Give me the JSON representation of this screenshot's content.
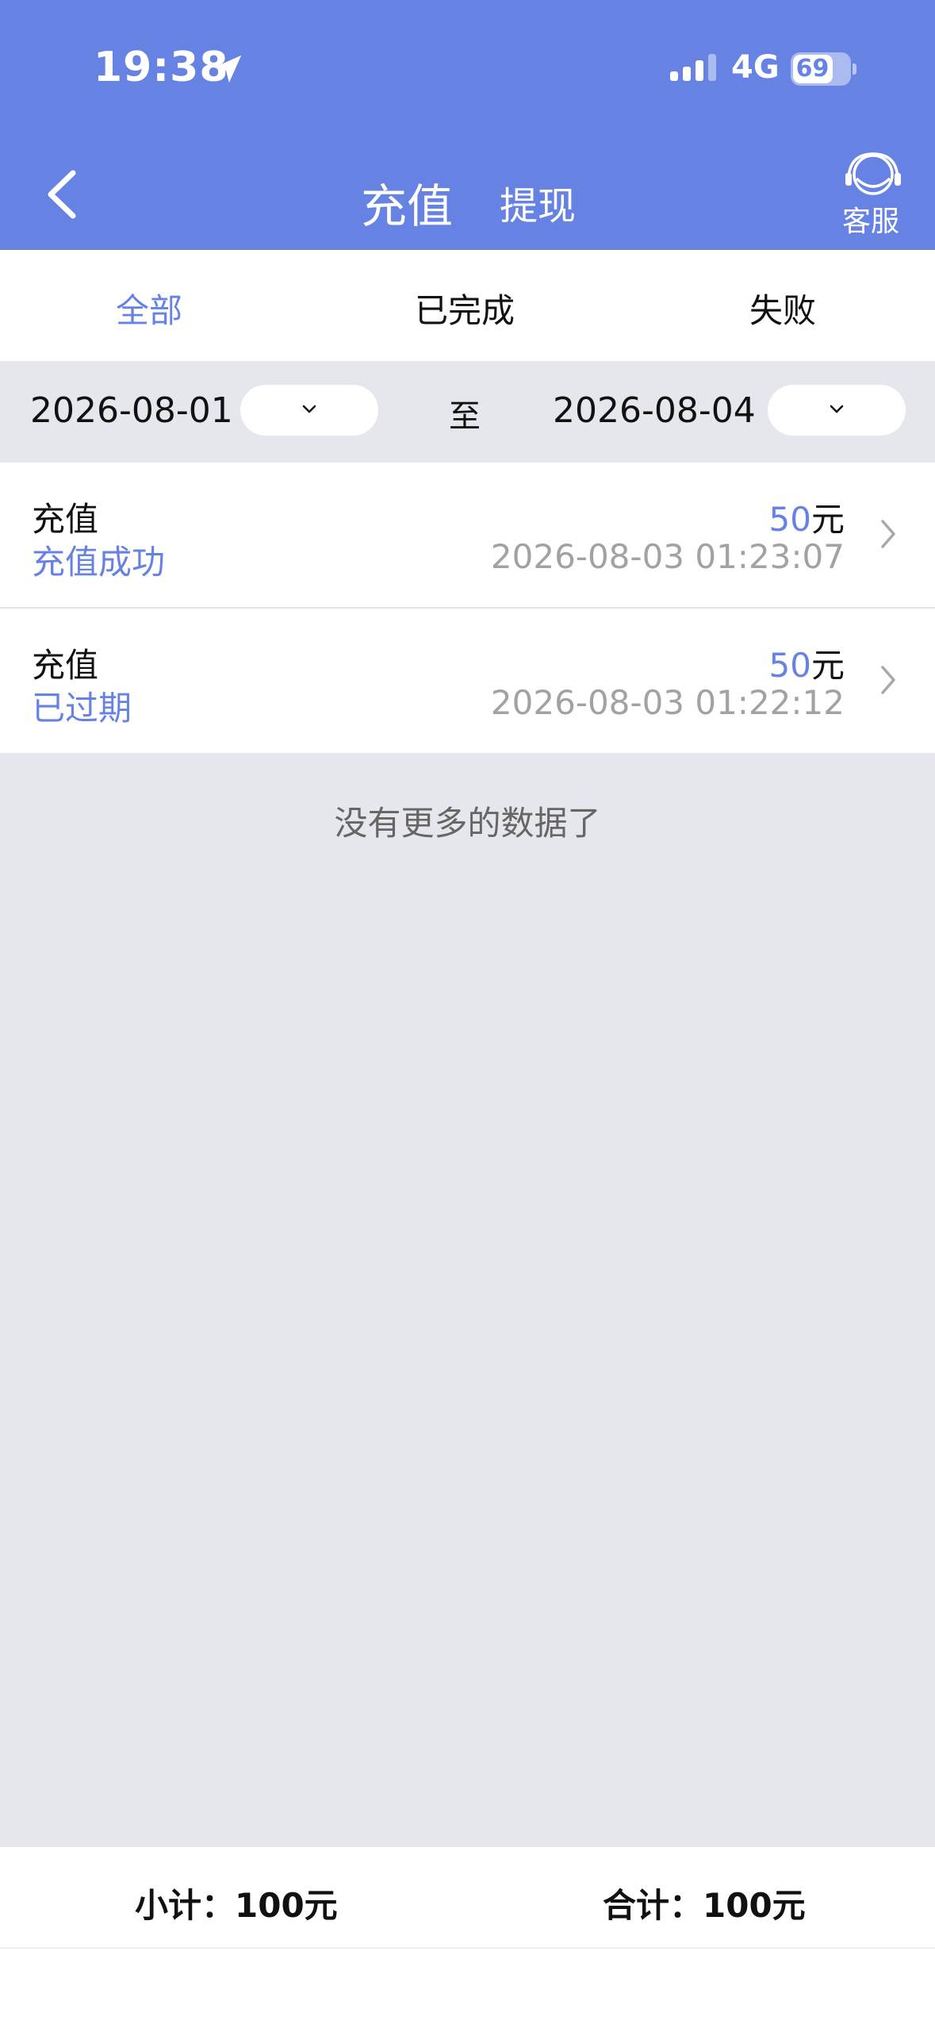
{
  "status_bar": {
    "time": "19:38",
    "network": "4G",
    "battery": "69"
  },
  "nav": {
    "tab_recharge": "充值",
    "tab_withdraw": "提现",
    "customer_service": "客服"
  },
  "filters": [
    "全部",
    "已完成",
    "失败"
  ],
  "date_range": {
    "start": "2026-08-01",
    "to": "至",
    "end": "2026-08-04"
  },
  "records": [
    {
      "title": "充值",
      "status": "充值成功",
      "amount": "50",
      "unit": "元",
      "time": "2026-08-03 01:23:07"
    },
    {
      "title": "充值",
      "status": "已过期",
      "amount": "50",
      "unit": "元",
      "time": "2026-08-03 01:22:12"
    }
  ],
  "no_more": "没有更多的数据了",
  "summary": {
    "subtotal": "小计：100元",
    "total": "合计：100元"
  },
  "colors": {
    "brand": "#6683e3",
    "background": "#e6e7ec"
  }
}
